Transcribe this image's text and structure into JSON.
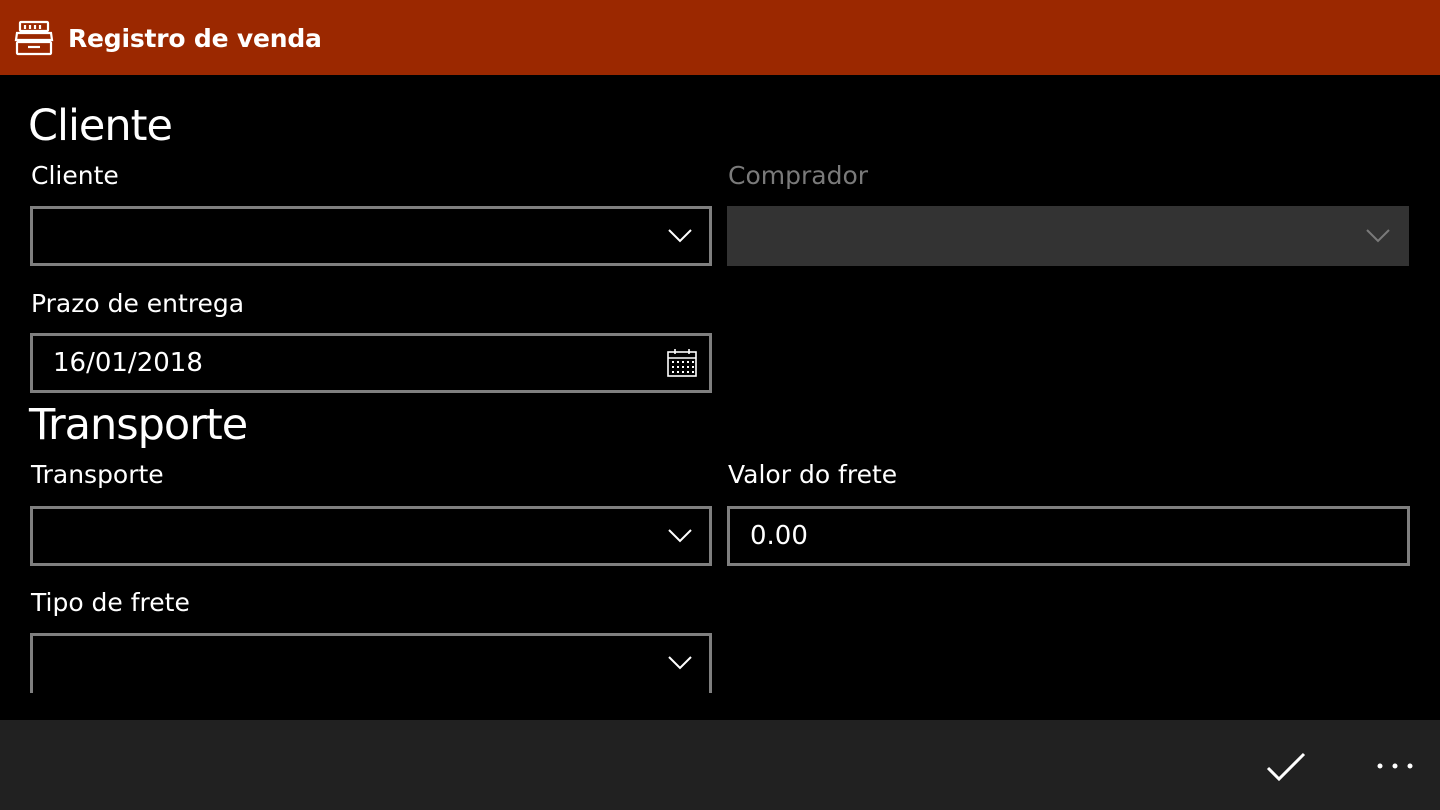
{
  "header": {
    "title": "Registro de venda",
    "background": "#9b2800",
    "icon": "cash-register-icon"
  },
  "sections": {
    "cliente": {
      "title": "Cliente",
      "cliente_label": "Cliente",
      "cliente_value": "",
      "comprador_label": "Comprador",
      "comprador_value": "",
      "prazo_label": "Prazo de entrega",
      "prazo_value": "16/01/2018"
    },
    "transporte": {
      "title": "Transporte",
      "transporte_label": "Transporte",
      "transporte_value": "",
      "valor_frete_label": "Valor do frete",
      "valor_frete_value": "0.00",
      "tipo_frete_label": "Tipo de frete",
      "tipo_frete_value": ""
    }
  },
  "appbar": {
    "accept_icon": "checkmark-icon",
    "more_icon": "more-dots-icon",
    "background": "#212121"
  }
}
